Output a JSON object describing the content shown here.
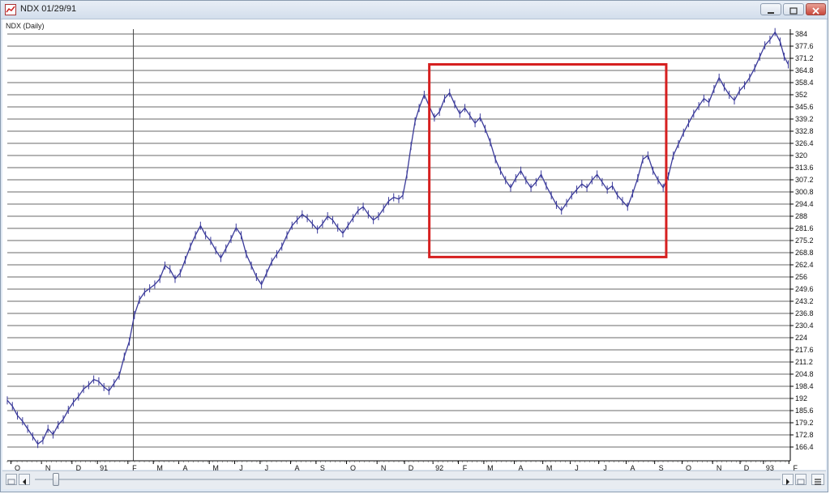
{
  "window": {
    "title": "NDX 01/29/91",
    "colors": {
      "frame": "#dfe8f3",
      "close": "#c8483c"
    }
  },
  "chart_data": {
    "type": "line",
    "title": "NDX (Daily)",
    "series": [
      {
        "values": [
          [
            0,
            191
          ],
          [
            0.5,
            188
          ],
          [
            1,
            183
          ],
          [
            1.5,
            180
          ],
          [
            2,
            176
          ],
          [
            2.5,
            172
          ],
          [
            3,
            168
          ],
          [
            3.5,
            170
          ],
          [
            4,
            176
          ],
          [
            4.5,
            173
          ],
          [
            5,
            178
          ],
          [
            5.5,
            181
          ],
          [
            6,
            186
          ],
          [
            6.5,
            190
          ],
          [
            7,
            193
          ],
          [
            7.5,
            197
          ],
          [
            8,
            199
          ],
          [
            8.5,
            202
          ],
          [
            9,
            201
          ],
          [
            9.5,
            198
          ],
          [
            10,
            196
          ],
          [
            10.5,
            200
          ],
          [
            11,
            204
          ],
          [
            11.5,
            214
          ],
          [
            12,
            222
          ],
          [
            12.5,
            236
          ],
          [
            13,
            244
          ],
          [
            13.5,
            248
          ],
          [
            14,
            250
          ],
          [
            14.5,
            252
          ],
          [
            15,
            255
          ],
          [
            15.5,
            262
          ],
          [
            16,
            260
          ],
          [
            16.5,
            255
          ],
          [
            17,
            258
          ],
          [
            17.5,
            265
          ],
          [
            18,
            272
          ],
          [
            18.5,
            278
          ],
          [
            19,
            283
          ],
          [
            19.5,
            278
          ],
          [
            20,
            275
          ],
          [
            20.5,
            270
          ],
          [
            21,
            266
          ],
          [
            21.5,
            271
          ],
          [
            22,
            276
          ],
          [
            22.5,
            282
          ],
          [
            23,
            278
          ],
          [
            23.5,
            268
          ],
          [
            24,
            262
          ],
          [
            24.5,
            256
          ],
          [
            25,
            252
          ],
          [
            25.5,
            258
          ],
          [
            26,
            264
          ],
          [
            26.5,
            268
          ],
          [
            27,
            272
          ],
          [
            27.5,
            278
          ],
          [
            28,
            283
          ],
          [
            28.5,
            286
          ],
          [
            29,
            289
          ],
          [
            29.5,
            287
          ],
          [
            30,
            284
          ],
          [
            30.5,
            281
          ],
          [
            31,
            284
          ],
          [
            31.5,
            288
          ],
          [
            32,
            286
          ],
          [
            32.5,
            282
          ],
          [
            33,
            279
          ],
          [
            33.5,
            283
          ],
          [
            34,
            287
          ],
          [
            34.5,
            291
          ],
          [
            35,
            293
          ],
          [
            35.5,
            289
          ],
          [
            36,
            286
          ],
          [
            36.5,
            288
          ],
          [
            37,
            292
          ],
          [
            37.5,
            296
          ],
          [
            38,
            298
          ],
          [
            38.5,
            297
          ],
          [
            38.9,
            299
          ],
          [
            39.3,
            310
          ],
          [
            39.7,
            325
          ],
          [
            40.1,
            338
          ],
          [
            40.5,
            345
          ],
          [
            41,
            352
          ],
          [
            41.5,
            346
          ],
          [
            42,
            340
          ],
          [
            42.5,
            343
          ],
          [
            43,
            350
          ],
          [
            43.5,
            353
          ],
          [
            44,
            347
          ],
          [
            44.5,
            342
          ],
          [
            45,
            345
          ],
          [
            45.5,
            341
          ],
          [
            46,
            337
          ],
          [
            46.5,
            340
          ],
          [
            47,
            334
          ],
          [
            47.5,
            327
          ],
          [
            48,
            318
          ],
          [
            48.5,
            312
          ],
          [
            49,
            307
          ],
          [
            49.5,
            303
          ],
          [
            50,
            308
          ],
          [
            50.5,
            312
          ],
          [
            51,
            307
          ],
          [
            51.5,
            303
          ],
          [
            52,
            306
          ],
          [
            52.5,
            310
          ],
          [
            53,
            304
          ],
          [
            53.5,
            299
          ],
          [
            54,
            294
          ],
          [
            54.5,
            291
          ],
          [
            55,
            295
          ],
          [
            55.5,
            299
          ],
          [
            56,
            302
          ],
          [
            56.5,
            305
          ],
          [
            57,
            303
          ],
          [
            57.5,
            307
          ],
          [
            58,
            310
          ],
          [
            58.5,
            306
          ],
          [
            59,
            302
          ],
          [
            59.5,
            304
          ],
          [
            60,
            299
          ],
          [
            60.5,
            296
          ],
          [
            61,
            293
          ],
          [
            61.5,
            300
          ],
          [
            62,
            308
          ],
          [
            62.5,
            318
          ],
          [
            63,
            320
          ],
          [
            63.5,
            312
          ],
          [
            64,
            307
          ],
          [
            64.5,
            303
          ],
          [
            65,
            309
          ],
          [
            65.5,
            320
          ],
          [
            66,
            326
          ],
          [
            66.5,
            332
          ],
          [
            67,
            337
          ],
          [
            67.5,
            342
          ],
          [
            68,
            346
          ],
          [
            68.5,
            350
          ],
          [
            69,
            348
          ],
          [
            69.5,
            355
          ],
          [
            70,
            361
          ],
          [
            70.5,
            356
          ],
          [
            71,
            352
          ],
          [
            71.5,
            349
          ],
          [
            72,
            354
          ],
          [
            72.5,
            357
          ],
          [
            73,
            361
          ],
          [
            73.5,
            366
          ],
          [
            74,
            372
          ],
          [
            74.5,
            378
          ],
          [
            75,
            381
          ],
          [
            75.5,
            385
          ],
          [
            76,
            380
          ],
          [
            76.4,
            372
          ],
          [
            76.8,
            368
          ]
        ]
      }
    ],
    "ylim": [
      166.4,
      384
    ],
    "xlim": [
      0,
      77
    ],
    "y_ticks": [
      "384",
      "377.6",
      "371.2",
      "364.8",
      "358.4",
      "352",
      "345.6",
      "339.2",
      "332.8",
      "326.4",
      "320",
      "313.6",
      "307.2",
      "300.8",
      "294.4",
      "288",
      "281.6",
      "275.2",
      "268.8",
      "262.4",
      "256",
      "249.6",
      "243.2",
      "236.8",
      "230.4",
      "224",
      "217.6",
      "211.2",
      "204.8",
      "198.4",
      "192",
      "185.6",
      "179.2",
      "172.8",
      "166.4"
    ],
    "x_ticks": [
      {
        "label": "O",
        "x": 1
      },
      {
        "label": "N",
        "x": 4
      },
      {
        "label": "D",
        "x": 7
      },
      {
        "label": "91",
        "x": 9.5
      },
      {
        "label": "F",
        "x": 12.5
      },
      {
        "label": "M",
        "x": 15
      },
      {
        "label": "A",
        "x": 17.5
      },
      {
        "label": "M",
        "x": 20.5
      },
      {
        "label": "J",
        "x": 23
      },
      {
        "label": "J",
        "x": 25.5
      },
      {
        "label": "A",
        "x": 28.5
      },
      {
        "label": "S",
        "x": 31
      },
      {
        "label": "O",
        "x": 34
      },
      {
        "label": "N",
        "x": 37
      },
      {
        "label": "D",
        "x": 39.7
      },
      {
        "label": "92",
        "x": 42.5
      },
      {
        "label": "F",
        "x": 45
      },
      {
        "label": "M",
        "x": 47.5
      },
      {
        "label": "A",
        "x": 50.5
      },
      {
        "label": "M",
        "x": 53.3
      },
      {
        "label": "J",
        "x": 56
      },
      {
        "label": "J",
        "x": 58.8
      },
      {
        "label": "A",
        "x": 61.5
      },
      {
        "label": "S",
        "x": 64.3
      },
      {
        "label": "O",
        "x": 67
      },
      {
        "label": "N",
        "x": 70
      },
      {
        "label": "D",
        "x": 72.7
      },
      {
        "label": "93",
        "x": 75
      },
      {
        "label": "F",
        "x": 77.5
      }
    ],
    "grid": "horizontal",
    "marker_line_x": 12.4,
    "highlight_box": {
      "x0": 41.5,
      "x1": 64.8,
      "y0": 266.5,
      "y1": 368,
      "color": "#d62020"
    },
    "line_color": "#3a3a9a"
  }
}
